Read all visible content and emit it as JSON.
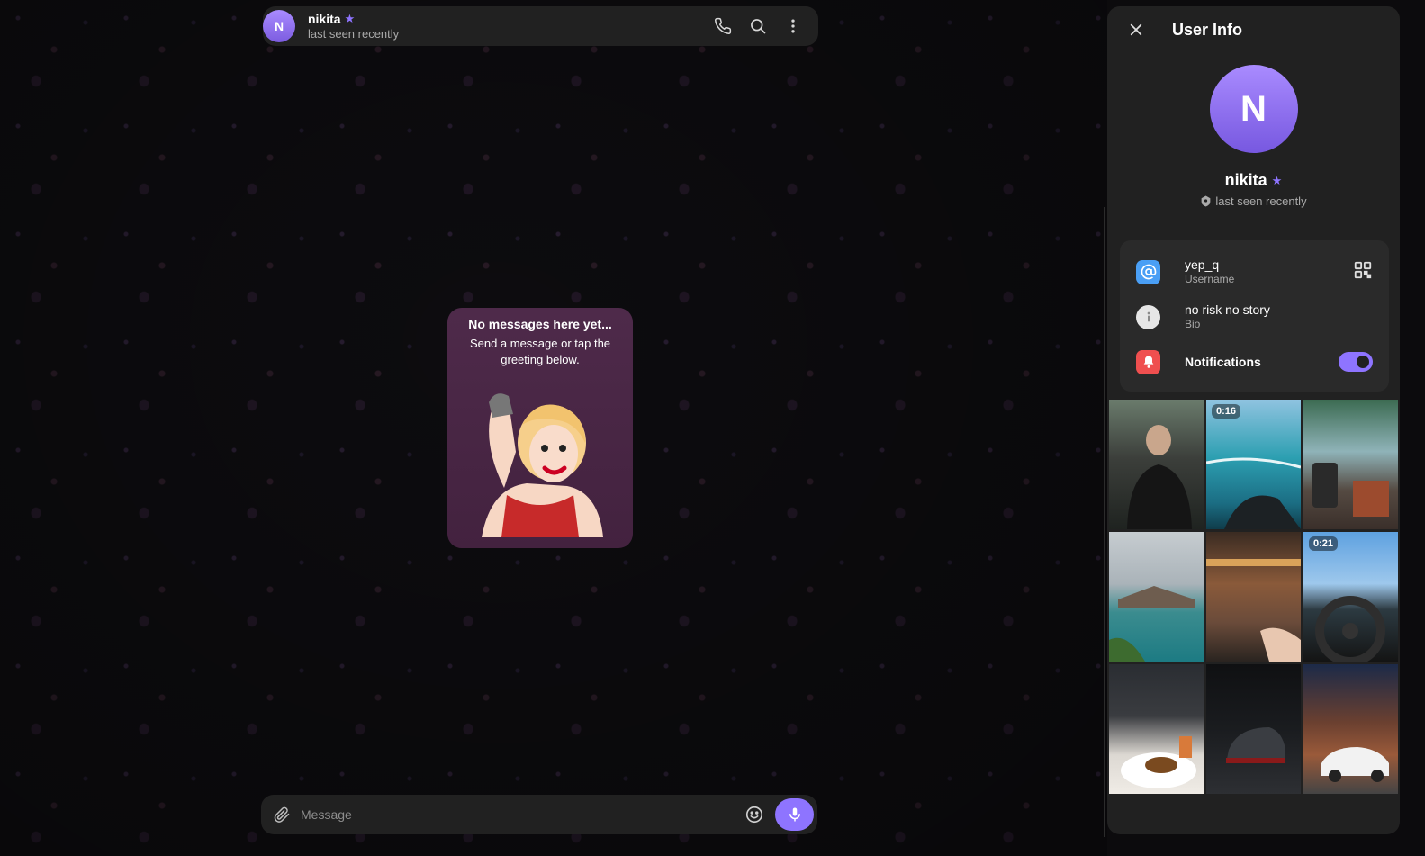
{
  "chat": {
    "peer": {
      "initial": "N",
      "name": "nikita",
      "status": "last seen recently"
    },
    "icons": [
      "phone-icon",
      "search-icon",
      "more-vertical-icon"
    ],
    "empty_state": {
      "title": "No messages here yet...",
      "subtitle": "Send a message or tap the greeting below."
    },
    "composer": {
      "placeholder": "Message"
    }
  },
  "panel": {
    "title": "User Info",
    "profile": {
      "initial": "N",
      "name": "nikita",
      "status": "last seen recently"
    },
    "info": {
      "username_value": "yep_q",
      "username_label": "Username",
      "bio_value": "no risk no story",
      "bio_label": "Bio",
      "notifications_label": "Notifications",
      "notifications_on": true
    },
    "media": [
      {
        "duration": ""
      },
      {
        "duration": "0:16"
      },
      {
        "duration": ""
      },
      {
        "duration": ""
      },
      {
        "duration": ""
      },
      {
        "duration": "0:21"
      },
      {
        "duration": ""
      },
      {
        "duration": ""
      },
      {
        "duration": ""
      }
    ]
  },
  "colors": {
    "accent": "#8e74ff",
    "panel_bg": "#212121",
    "card_bg": "#2a2a2a",
    "empty_card_bg": "#4e2a4a",
    "username_icon": "#4a9ff5",
    "bio_icon": "#e6e6e6",
    "notification_icon": "#ef4f4f"
  }
}
